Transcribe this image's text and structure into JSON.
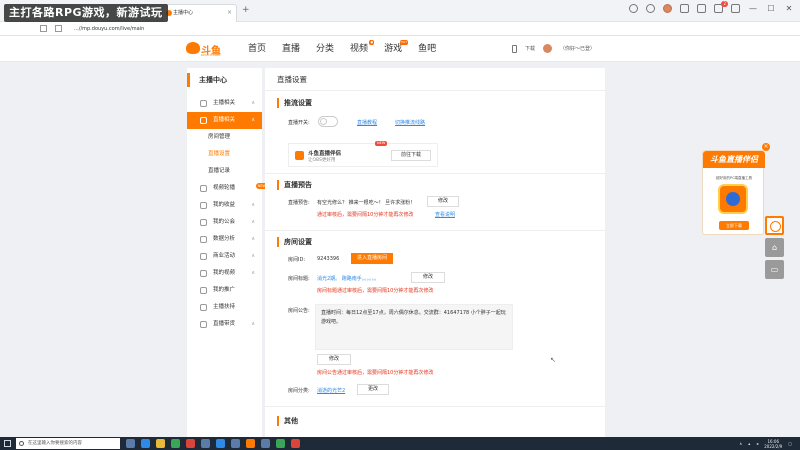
{
  "overlay": {
    "banner": "主打各路RPG游戏，新游试玩"
  },
  "browser": {
    "tab_title": "主播中心",
    "tab_close": "×",
    "new_tab": "+",
    "address": "...//mp.douyu.com/live/main",
    "notif_count": "2",
    "win_min": "—",
    "win_max": "☐",
    "win_close": "✕"
  },
  "header": {
    "logo_text": "斗鱼",
    "logo_sub": "DOUYU.COM",
    "nav": [
      {
        "label": "首页"
      },
      {
        "label": "直播"
      },
      {
        "label": "分类"
      },
      {
        "label": "视频",
        "badge": "●"
      },
      {
        "label": "游戏",
        "badge": "HOT"
      },
      {
        "label": "鱼吧"
      }
    ],
    "download": "下载",
    "user_label": "（你好～已登）"
  },
  "sidebar": {
    "title": "主播中心",
    "items": [
      {
        "label": "主播相关",
        "chevron": "∧"
      },
      {
        "label": "直播相关",
        "chevron": "∧"
      },
      {
        "label": "房间管理"
      },
      {
        "label": "直播设置"
      },
      {
        "label": "直播记录"
      },
      {
        "label": "视频轮播",
        "tag": "NEW"
      },
      {
        "label": "我的收益",
        "chevron": "∧"
      },
      {
        "label": "我的公会",
        "chevron": "∧"
      },
      {
        "label": "数据分析",
        "chevron": "∧"
      },
      {
        "label": "商业活动",
        "chevron": "∧"
      },
      {
        "label": "我的视频",
        "chevron": "∧"
      },
      {
        "label": "我的推广"
      },
      {
        "label": "主播扶持"
      },
      {
        "label": "直播带货",
        "chevron": "∧"
      }
    ]
  },
  "main": {
    "page_title": "直播设置",
    "push": {
      "section_title": "推流设置",
      "switch_label": "直播开关:",
      "tutorial_link": "直播教程",
      "switch_line_link": "切换推流线路",
      "companion_name": "斗鱼直播伴侣",
      "companion_desc": "让OBS更好用",
      "companion_new": "NEW",
      "download_btn": "前往下载"
    },
    "notice": {
      "section_title": "直播预告",
      "label": "直播预告:",
      "text": "有空光修么？ 推来一根吃～！ 旦许求涨粉！",
      "edit_btn": "修改",
      "tip": "通过审核后，需要间隔10分钟才能再次修改",
      "tip_link": "查看说明"
    },
    "room": {
      "section_title": "房间设置",
      "id_label": "房间ID:",
      "id_value": "9243396",
      "enter_btn": "进入直播房间",
      "title_label": "房间标题:",
      "title_value": "消光2期。 跑路南手。。。。。。",
      "title_edit": "修改",
      "title_tip": "房间标题通过审核后，需要间隔10分钟才能再次修改",
      "announce_label": "房间公告:",
      "announce_value": "直播时间：每日12点至17点，周六偶尔休息。交流群：41647178 小个胖子一起玩游戏吧。",
      "announce_edit": "修改",
      "announce_tip": "房间公告通过审核后，需要间隔10分钟才能再次修改",
      "category_label": "房间分类:",
      "category_value": "消逝的光芒2",
      "category_edit": "更改"
    },
    "other": {
      "section_title": "其他"
    }
  },
  "promo": {
    "title": "斗鱼直播伴侣",
    "subtitle": "超好用的PC端直播工具",
    "app_name": "DOUYU",
    "button": "立即下载",
    "close": "×"
  },
  "taskbar": {
    "search_placeholder": "在这里输入你要搜索的内容",
    "time": "16:06",
    "date": "2022/2/9"
  }
}
